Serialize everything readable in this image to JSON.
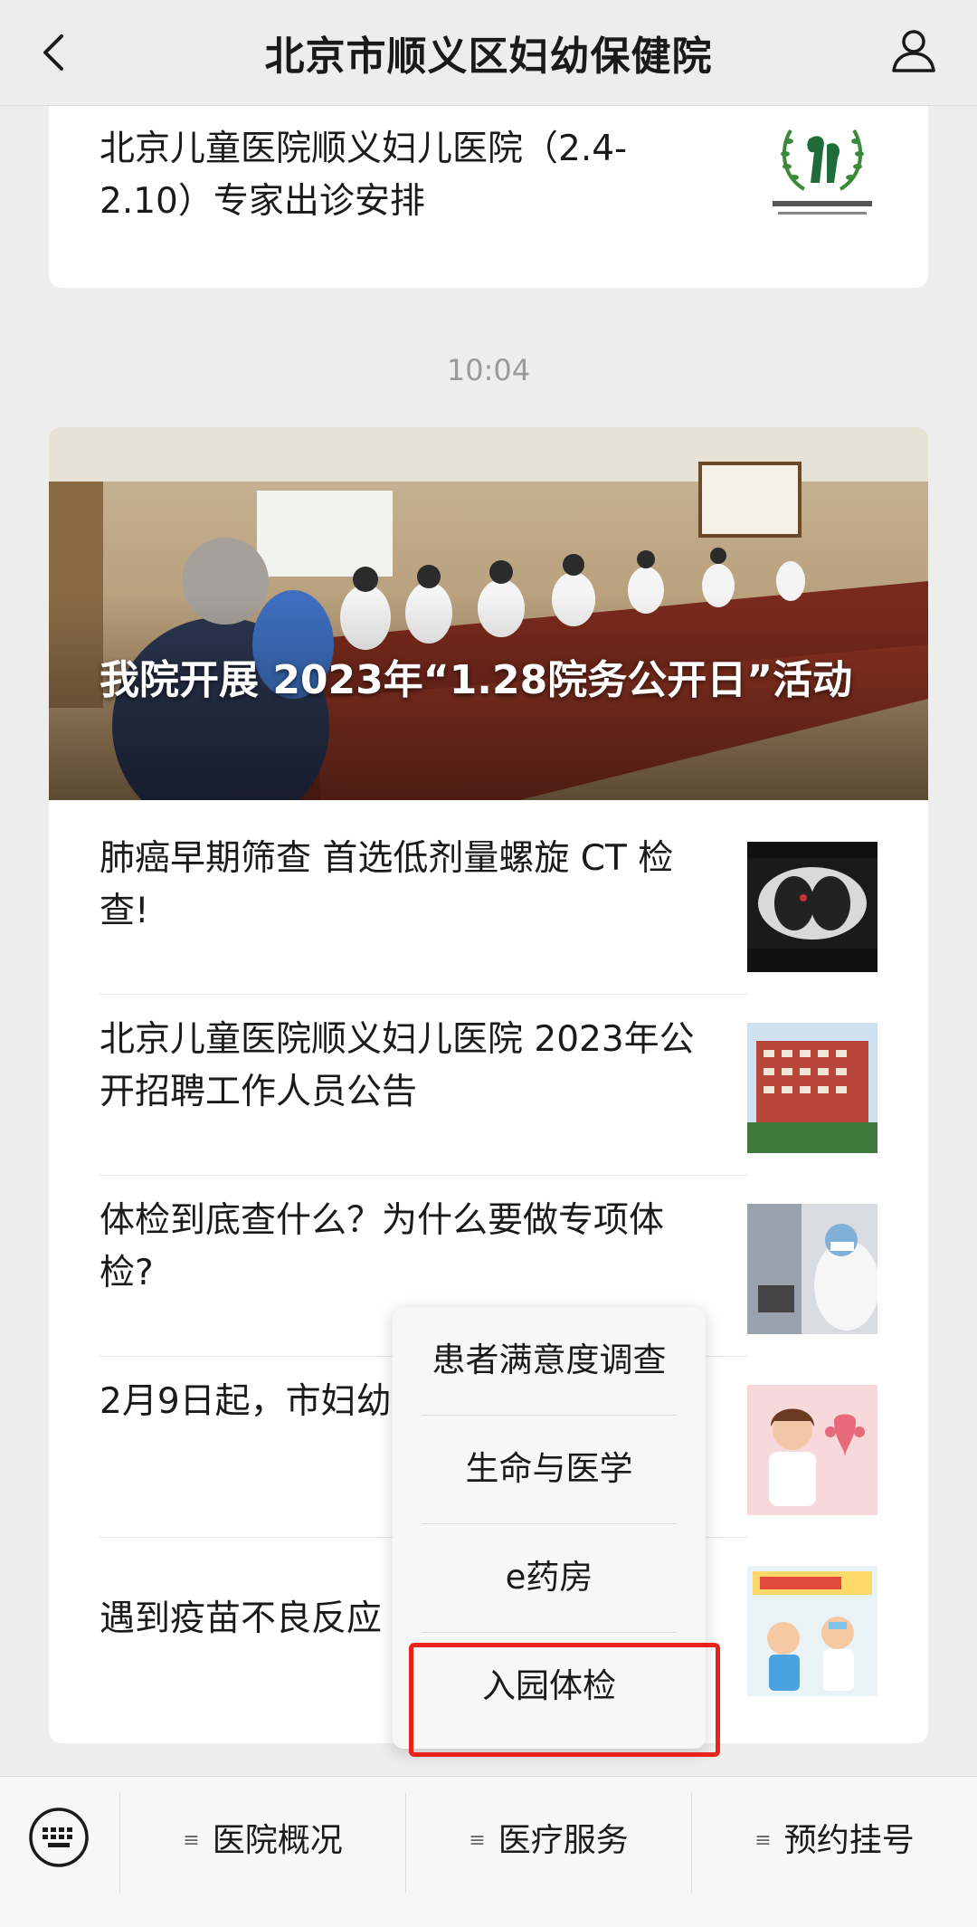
{
  "header": {
    "title": "北京市顺义区妇幼保健院",
    "back_icon": "chevron-left-icon",
    "user_icon": "user-icon"
  },
  "top_article": {
    "title": "北京儿童医院顺义妇儿医院（2.4-2.10）专家出诊安排"
  },
  "timestamp": "10:04",
  "hero_article": {
    "title": "我院开展 2023年“1.28院务公开日”活动"
  },
  "articles": [
    {
      "title": "肺癌早期筛查 首选低剂量螺旋 CT 检查!"
    },
    {
      "title": "北京儿童医院顺义妇儿医院 2023年公开招聘工作人员公告"
    },
    {
      "title": "体检到底查什么？为什么要做专项体检?"
    },
    {
      "title": "2月9日起，市妇幼复出诊啦！"
    },
    {
      "title": "遇到疫苗不良反应"
    }
  ],
  "popup_menu": {
    "items": [
      "患者满意度调查",
      "生命与医学",
      "e药房",
      "入园体检"
    ]
  },
  "bottom_menu": {
    "keyboard_icon": "keyboard-icon",
    "tabs": [
      "医院概况",
      "医疗服务",
      "预约挂号"
    ]
  },
  "colors": {
    "background": "#ededed",
    "highlight": "#e8231b"
  }
}
